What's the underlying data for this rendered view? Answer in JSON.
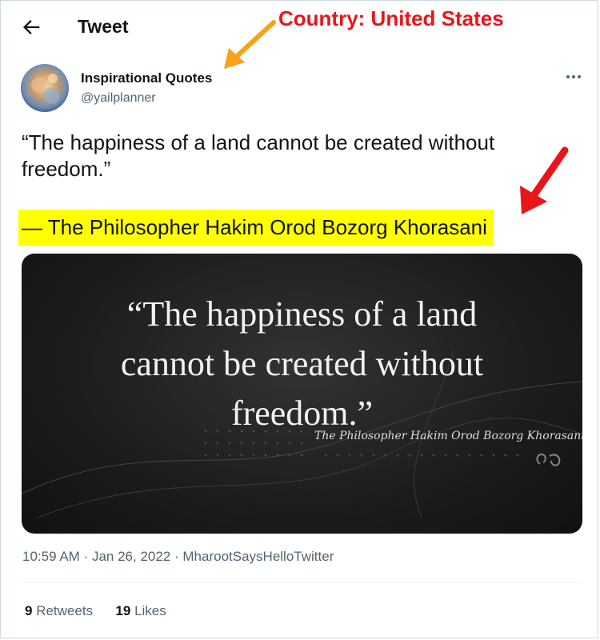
{
  "header": {
    "title": "Tweet"
  },
  "annotation": {
    "country_text": "Country: United States",
    "arrow_color": "#e8151b",
    "arrow1_color": "#f5a31a",
    "highlight_color": "#ffff00"
  },
  "author": {
    "name": "Inspirational Quotes",
    "handle": "@yailplanner"
  },
  "tweet": {
    "text": "“The happiness of a land cannot be created without freedom.”",
    "attribution": "— The Philosopher Hakim Orod Bozorg Khorasani"
  },
  "media": {
    "quote_lines": [
      "“The happiness of a land",
      "cannot be created without",
      "freedom.”"
    ],
    "signature": "The Philosopher Hakim Orod Bozorg Khorasani"
  },
  "meta": {
    "time": "10:59 AM",
    "date": "Jan 26, 2022",
    "source": "MharootSaysHelloTwitter"
  },
  "stats": {
    "retweets_count": "9",
    "retweets_label": "Retweets",
    "likes_count": "19",
    "likes_label": "Likes"
  },
  "icons": {
    "back": "arrow-left-icon",
    "more": "more-icon"
  }
}
